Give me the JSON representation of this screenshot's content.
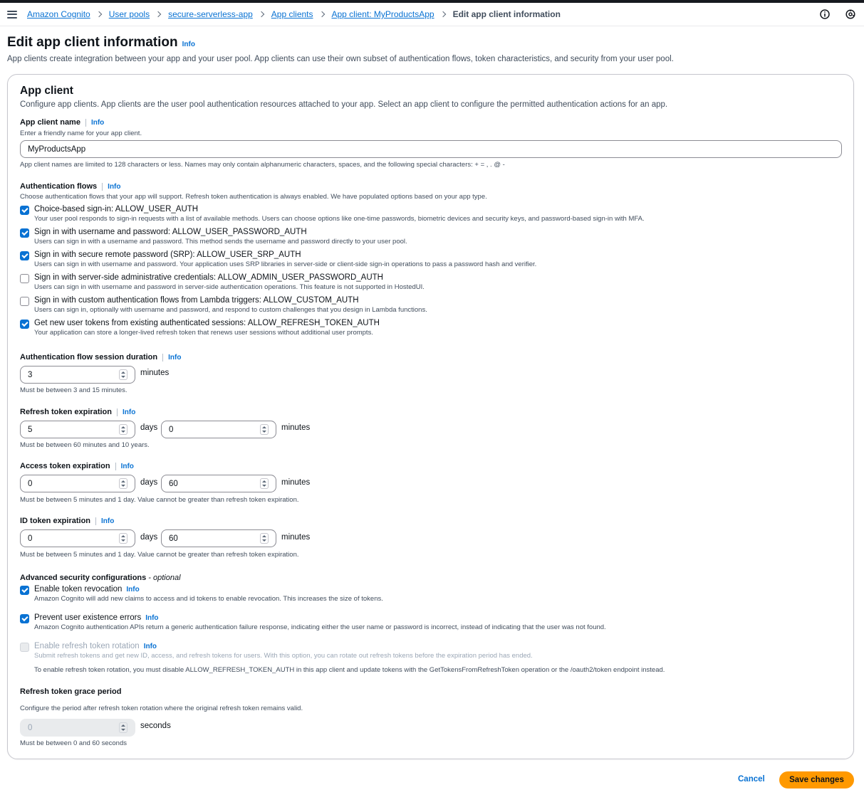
{
  "breadcrumb": {
    "items": [
      "Amazon Cognito",
      "User pools",
      "secure-serverless-app",
      "App clients",
      "App client: MyProductsApp"
    ],
    "current": "Edit app client information"
  },
  "page": {
    "title": "Edit app client information",
    "info": "Info",
    "description": "App clients create integration between your app and your user pool. App clients can use their own subset of authentication flows, token characteristics, and security from your user pool."
  },
  "panel": {
    "title": "App client",
    "description": "Configure app clients. App clients are the user pool authentication resources attached to your app. Select an app client to configure the permitted authentication actions for an app."
  },
  "client_name": {
    "label": "App client name",
    "info": "Info",
    "hint": "Enter a friendly name for your app client.",
    "value": "MyProductsApp",
    "constraint": "App client names are limited to 128 characters or less. Names may only contain alphanumeric characters, spaces, and the following special characters: + = , . @ -"
  },
  "auth_flows": {
    "label": "Authentication flows",
    "info": "Info",
    "hint": "Choose authentication flows that your app will support. Refresh token authentication is always enabled. We have populated options based on your app type.",
    "options": [
      {
        "label": "Choice-based sign-in: ALLOW_USER_AUTH",
        "desc": "Your user pool responds to sign-in requests with a list of available methods. Users can choose options like one-time passwords, biometric devices and security keys, and password-based sign-in with MFA.",
        "checked": true
      },
      {
        "label": "Sign in with username and password: ALLOW_USER_PASSWORD_AUTH",
        "desc": "Users can sign in with a username and password. This method sends the username and password directly to your user pool.",
        "checked": true
      },
      {
        "label": "Sign in with secure remote password (SRP): ALLOW_USER_SRP_AUTH",
        "desc": "Users can sign in with username and password. Your application uses SRP libraries in server-side or client-side sign-in operations to pass a password hash and verifier.",
        "checked": true
      },
      {
        "label": "Sign in with server-side administrative credentials: ALLOW_ADMIN_USER_PASSWORD_AUTH",
        "desc": "Users can sign in with username and password in server-side authentication operations. This feature is not supported in HostedUI.",
        "checked": false
      },
      {
        "label": "Sign in with custom authentication flows from Lambda triggers: ALLOW_CUSTOM_AUTH",
        "desc": "Users can sign in, optionally with username and password, and respond to custom challenges that you design in Lambda functions.",
        "checked": false
      },
      {
        "label": "Get new user tokens from existing authenticated sessions: ALLOW_REFRESH_TOKEN_AUTH",
        "desc": "Your application can store a longer-lived refresh token that renews user sessions without additional user prompts.",
        "checked": true
      }
    ]
  },
  "session_duration": {
    "label": "Authentication flow session duration",
    "info": "Info",
    "value": "3",
    "unit": "minutes",
    "constraint": "Must be between 3 and 15 minutes."
  },
  "refresh_expiration": {
    "label": "Refresh token expiration",
    "info": "Info",
    "days": "5",
    "days_unit": "days",
    "minutes": "0",
    "minutes_unit": "minutes",
    "constraint": "Must be between 60 minutes and 10 years."
  },
  "access_expiration": {
    "label": "Access token expiration",
    "info": "Info",
    "days": "0",
    "days_unit": "days",
    "minutes": "60",
    "minutes_unit": "minutes",
    "constraint": "Must be between 5 minutes and 1 day. Value cannot be greater than refresh token expiration."
  },
  "id_expiration": {
    "label": "ID token expiration",
    "info": "Info",
    "days": "0",
    "days_unit": "days",
    "minutes": "60",
    "minutes_unit": "minutes",
    "constraint": "Must be between 5 minutes and 1 day. Value cannot be greater than refresh token expiration."
  },
  "advanced": {
    "label": "Advanced security configurations",
    "optional": "- optional",
    "token_revocation": {
      "label": "Enable token revocation",
      "info": "Info",
      "desc": "Amazon Cognito will add new claims to access and id tokens to enable revocation. This increases the size of tokens.",
      "checked": true
    },
    "prevent_existence": {
      "label": "Prevent user existence errors",
      "info": "Info",
      "desc": "Amazon Cognito authentication APIs return a generic authentication failure response, indicating either the user name or password is incorrect, instead of indicating that the user was not found.",
      "checked": true
    },
    "refresh_rotation": {
      "label": "Enable refresh token rotation",
      "info": "Info",
      "desc": "Submit refresh tokens and get new ID, access, and refresh tokens for users. With this option, you can rotate out refresh tokens before the expiration period has ended.",
      "note": "To enable refresh token rotation, you must disable ALLOW_REFRESH_TOKEN_AUTH in this app client and update tokens with the GetTokensFromRefreshToken operation or the /oauth2/token endpoint instead.",
      "checked": false,
      "disabled": true
    }
  },
  "grace_period": {
    "label": "Refresh token grace period",
    "hint": "Configure the period after refresh token rotation where the original refresh token remains valid.",
    "value": "0",
    "unit": "seconds",
    "constraint": "Must be between 0 and 60 seconds"
  },
  "footer": {
    "cancel": "Cancel",
    "save": "Save changes"
  }
}
